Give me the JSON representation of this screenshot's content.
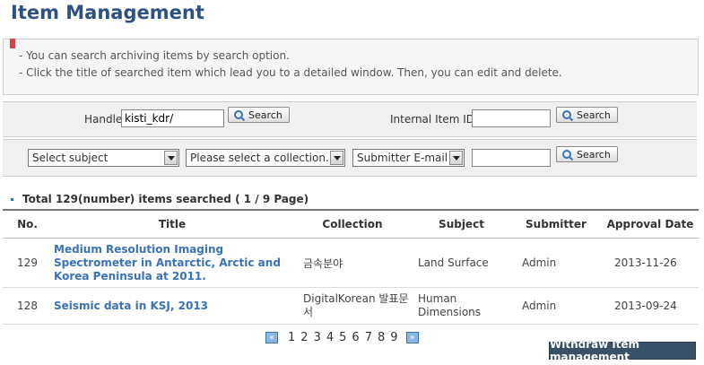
{
  "page": {
    "title": "Item Management"
  },
  "info": {
    "line1": "- You can search archiving items by search option.",
    "line2": "- Click the title of searched item which lead you to a detailed window. Then, you can edit and delete."
  },
  "search": {
    "handle_label": "Handle",
    "handle_value": "kisti_kdr/",
    "internal_id_label": "Internal Item ID",
    "internal_id_value": "",
    "search_label": "Search",
    "subject_select": "Select subject",
    "collection_select": "Please select a collection.",
    "submitter_select": "Submitter E-mail",
    "submitter_value": ""
  },
  "results": {
    "total_text": "Total 129(number) items searched ( 1 / 9 Page)",
    "columns": [
      "No.",
      "Title",
      "Collection",
      "Subject",
      "Submitter",
      "Approval Date"
    ],
    "rows": [
      {
        "no": "129",
        "title": "Medium Resolution Imaging Spectrometer in Antarctic, Arctic and Korea Peninsula at 2011.",
        "collection": "금속분야",
        "subject": "Land Surface",
        "submitter": "Admin",
        "date": "2013-11-26"
      },
      {
        "no": "128",
        "title": "Seismic data in KSJ, 2013",
        "collection": "DigitalKorean 발표문서",
        "subject": "Human Dimensions",
        "submitter": "Admin",
        "date": "2013-09-24"
      }
    ]
  },
  "pager": {
    "prev": "«",
    "next": "»",
    "pages": [
      "1",
      "2",
      "3",
      "4",
      "5",
      "6",
      "7",
      "8",
      "9"
    ]
  },
  "actions": {
    "withdraw": "Withdraw item management"
  },
  "colors": {
    "title": "#2d5282",
    "link": "#3a72b8",
    "withdraw_bg": "#3a4f68"
  }
}
